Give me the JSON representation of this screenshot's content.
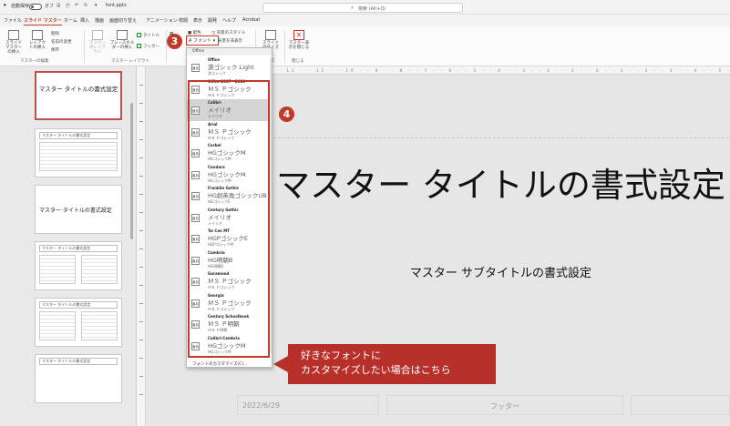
{
  "titlebar": {
    "autosave": "自動保存",
    "toggle_state": "オフ",
    "filename": "font.pptx",
    "search_placeholder": "検索 (Alt+Q)"
  },
  "menu": {
    "tabs": [
      "ファイル",
      "スライド マスター",
      "ホーム",
      "挿入",
      "描画",
      "画面切り替え",
      "アニメーション",
      "校閲",
      "表示",
      "開発",
      "ヘルプ",
      "Acrobat"
    ],
    "active_index": 1
  },
  "ribbon": {
    "insert_slide_master": "スライド マスターの挿入",
    "insert_layout": "レイアウトの挿入",
    "delete": "削除",
    "rename": "名前の変更",
    "preserve": "保存",
    "master_layout": "マスターのレイアウト",
    "insert_placeholder": "プレースホルダーの挿入",
    "title_check": "タイトル",
    "footer_check": "フッター",
    "group_master_edit": "マスターの編集",
    "group_master_layout": "マスター レイアウト",
    "colors": "配色",
    "fonts": "フォント",
    "background_styles": "背景のスタイル",
    "hide_background": "背景を非表示",
    "slide_size": "スライドのサイズ",
    "close_master": "マスター表示を閉じる",
    "group_slide_size": "サイズ",
    "group_close": "閉じる"
  },
  "dropdown": {
    "header": "Office",
    "items": [
      {
        "name": "Office",
        "heading": "游ゴシック Light",
        "body": "游ゴシック",
        "icon": "亜あ"
      },
      {
        "name": "Office 2007 - 2010",
        "heading": "ＭＳ Ｐゴシック",
        "body": "ＭＳ Ｐゴシック",
        "icon": "亜あ"
      },
      {
        "name": "Calibri",
        "heading": "メイリオ",
        "body": "メイリオ",
        "icon": "亜あ"
      },
      {
        "name": "Arial",
        "heading": "ＭＳ Ｐゴシック",
        "body": "ＭＳ Ｐゴシック",
        "icon": "亜あ"
      },
      {
        "name": "Corbel",
        "heading": "HGゴシックM",
        "body": "HGゴシックM",
        "icon": "亜あ"
      },
      {
        "name": "Candara",
        "heading": "HGゴシックM",
        "body": "HGゴシックM",
        "icon": "亜あ"
      },
      {
        "name": "Franklin Gothic",
        "heading": "HG創英角ゴシックUB",
        "body": "HGゴシックE",
        "icon": "亜あ"
      },
      {
        "name": "Century Gothic",
        "heading": "メイリオ",
        "body": "メイリオ",
        "icon": "亜あ"
      },
      {
        "name": "Tw Cen MT",
        "heading": "HGPゴシックE",
        "body": "HGPゴシックM",
        "icon": "亜あ"
      },
      {
        "name": "Cambria",
        "heading": "HG明朝B",
        "body": "HG明朝B",
        "icon": "亜あ"
      },
      {
        "name": "Garamond",
        "heading": "ＭＳ Ｐゴシック",
        "body": "ＭＳ Ｐゴシック",
        "icon": "亜あ"
      },
      {
        "name": "Georgia",
        "heading": "ＭＳ Ｐゴシック",
        "body": "ＭＳ Ｐゴシック",
        "icon": "亜あ"
      },
      {
        "name": "Century Schoolbook",
        "heading": "ＭＳ Ｐ明朝",
        "body": "ＭＳ Ｐ明朝",
        "icon": "亜あ"
      },
      {
        "name": "Calibri-Cambria",
        "heading": "HGゴシックM",
        "body": "HGゴシックM",
        "icon": "亜あ"
      }
    ],
    "highlight_index": 2,
    "customize": "フォントのカスタマイズ(C)..."
  },
  "thumbnails": [
    {
      "title": "マスター タイトルの書式設定"
    },
    {
      "title": "マスター タイトルの書式設定"
    },
    {
      "title": "マスター タイトルの書式設定"
    },
    {
      "title": "マスター タイトルの書式設定"
    },
    {
      "title": "マスター タイトルの書式設定"
    },
    {
      "title": "マスター タイトルの書式設定"
    }
  ],
  "slide": {
    "title": "マスター タイトルの書式設定",
    "subtitle": "マスター サブタイトルの書式設定",
    "date": "2022/6/29",
    "footer": "フッター"
  },
  "markers": {
    "step3": "3",
    "step4": "4"
  },
  "callout": {
    "line1": "好きなフォントに",
    "line2": "カスタマイズしたい場合はこちら"
  },
  "colors": {
    "accent": "#c0392b",
    "callout_bg": "#b7302a",
    "active_tab": "#b7472a"
  }
}
